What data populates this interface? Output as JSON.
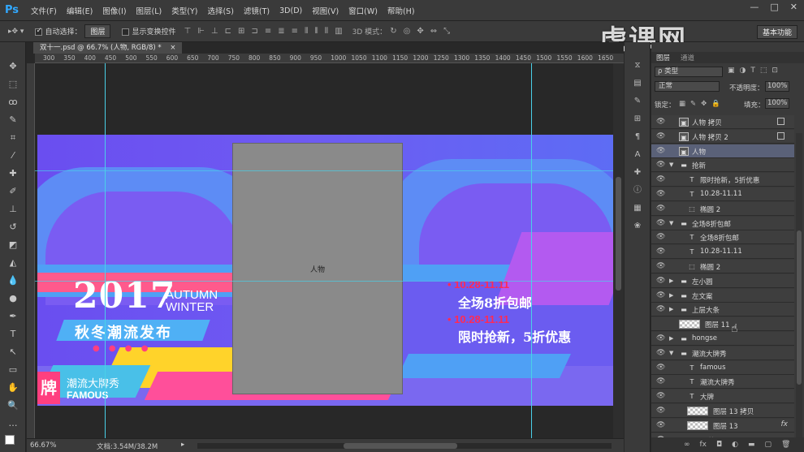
{
  "app": {
    "logo": "Ps"
  },
  "menu": [
    "文件(F)",
    "编辑(E)",
    "图像(I)",
    "图层(L)",
    "类型(Y)",
    "选择(S)",
    "滤镜(T)",
    "3D(D)",
    "视图(V)",
    "窗口(W)",
    "帮助(H)"
  ],
  "window_controls": {
    "min": "—",
    "max": "□",
    "close": "✕"
  },
  "options": {
    "auto_select_label": "自动选择：",
    "auto_select_value": "图层",
    "show_transform_label": "显示变换控件",
    "mode_3d_label": "3D 模式：",
    "workspace": "基本功能"
  },
  "watermark": "虎课网",
  "doc_tab": "双十一.psd @ 66.7% (人物, RGB/8) *",
  "ruler_ticks": [
    "300",
    "350",
    "400",
    "450",
    "500",
    "550",
    "600",
    "650",
    "700",
    "750",
    "800",
    "850",
    "900",
    "950",
    "1000",
    "1050",
    "1100",
    "1150",
    "1200",
    "1250",
    "1300",
    "1350",
    "1400",
    "1450",
    "1500",
    "1550",
    "1600",
    "1650"
  ],
  "banner": {
    "year": "2017",
    "autumn": "AUTUMN",
    "winter": "WINTER",
    "subtitle": "秋冬潮流发布",
    "date1": "• 10.28-11.11",
    "promo1": "全场8折包邮",
    "date2": "• 10.28-11.11",
    "promo2": "限时抢新，5折优惠",
    "brand_char": "牌",
    "brand_cn": "潮流大牌秀",
    "brand_en": "FAMOUS",
    "figure_label": "人物"
  },
  "status": {
    "zoom": "66.67%",
    "doc": "文档:3.54M/38.2M"
  },
  "layers_panel": {
    "tab1": "图层",
    "tab2": "通道",
    "filter": "ρ 类型",
    "blend_mode": "正常",
    "opacity_label": "不透明度：",
    "opacity_value": "100%",
    "lock_label": "锁定：",
    "fill_label": "填充：",
    "fill_value": "100%",
    "rows": [
      {
        "name": "人物 拷贝",
        "type": "smart",
        "indent": 0,
        "selected": false,
        "badge": true
      },
      {
        "name": "人物 拷贝 2",
        "type": "smart",
        "indent": 0,
        "selected": false,
        "badge": true
      },
      {
        "name": "人物",
        "type": "smart",
        "indent": 0,
        "selected": true,
        "badge": false
      },
      {
        "name": "抢新",
        "type": "folder-open",
        "indent": 0,
        "selected": false,
        "badge": false
      },
      {
        "name": "限时抢新，5折优惠",
        "type": "text",
        "indent": 1,
        "selected": false,
        "badge": false
      },
      {
        "name": "10.28-11.11",
        "type": "text",
        "indent": 1,
        "selected": false,
        "badge": false
      },
      {
        "name": "椭圆 2",
        "type": "shape",
        "indent": 1,
        "selected": false,
        "badge": false
      },
      {
        "name": "全场8折包邮",
        "type": "folder-open",
        "indent": 0,
        "selected": false,
        "badge": false
      },
      {
        "name": "全场8折包邮",
        "type": "text",
        "indent": 1,
        "selected": false,
        "badge": false
      },
      {
        "name": "10.28-11.11",
        "type": "text",
        "indent": 1,
        "selected": false,
        "badge": false
      },
      {
        "name": "椭圆 2",
        "type": "shape",
        "indent": 1,
        "selected": false,
        "badge": false
      },
      {
        "name": "左小圆",
        "type": "folder",
        "indent": 0,
        "selected": false,
        "badge": false
      },
      {
        "name": "左文案",
        "type": "folder",
        "indent": 0,
        "selected": false,
        "badge": false
      },
      {
        "name": "上层大条",
        "type": "folder",
        "indent": 0,
        "selected": false,
        "badge": false
      },
      {
        "name": "图层 11",
        "type": "pixel",
        "indent": 0,
        "selected": false,
        "badge": false
      },
      {
        "name": "hongse",
        "type": "folder",
        "indent": 0,
        "selected": false,
        "badge": false
      },
      {
        "name": "潮流大牌秀",
        "type": "folder-open",
        "indent": 0,
        "selected": false,
        "badge": false
      },
      {
        "name": "famous",
        "type": "text",
        "indent": 1,
        "selected": false,
        "badge": false
      },
      {
        "name": "潮流大牌秀",
        "type": "text",
        "indent": 1,
        "selected": false,
        "badge": false
      },
      {
        "name": "大牌",
        "type": "text",
        "indent": 1,
        "selected": false,
        "badge": false
      },
      {
        "name": "图层 13 拷贝",
        "type": "pixel",
        "indent": 1,
        "selected": false,
        "badge": false
      },
      {
        "name": "图层 13",
        "type": "pixel",
        "indent": 1,
        "selected": false,
        "badge": false,
        "fx": "fx"
      },
      {
        "name": "效果",
        "type": "effect",
        "indent": 2,
        "selected": false,
        "badge": false
      }
    ]
  },
  "colors": {
    "banner_bg": "#6a4ef0",
    "accent_pink": "#ff3f7f",
    "accent_cyan": "#4ad0e8",
    "text_red": "#ff2a55",
    "selected_layer": "#5a6178"
  }
}
